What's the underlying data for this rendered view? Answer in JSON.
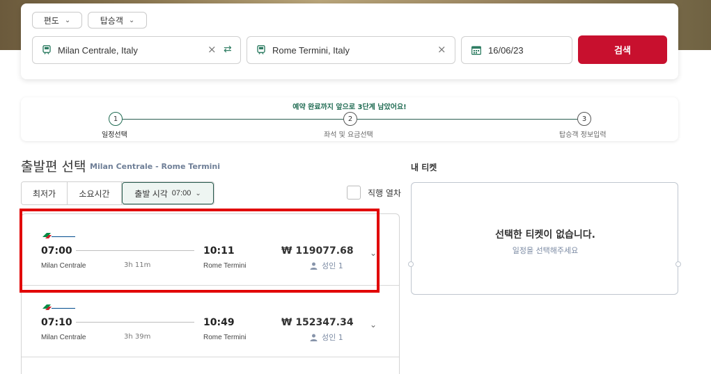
{
  "search": {
    "trip_type_label": "편도",
    "passengers_label": "탑승객",
    "origin": "Milan Centrale, Italy",
    "destination": "Rome Termini, Italy",
    "date": "16/06/23",
    "search_button": "검색"
  },
  "progress": {
    "message": "예약 완료까지 앞으로 3단계 남았어요!",
    "steps": [
      {
        "number": "1",
        "label": "일정선택",
        "active": true
      },
      {
        "number": "2",
        "label": "좌석 및 요금선택",
        "active": false
      },
      {
        "number": "3",
        "label": "탑승객 정보입력",
        "active": false
      }
    ]
  },
  "departure": {
    "title": "출발편 선택",
    "route": "Milan Centrale - Rome Termini"
  },
  "sort": {
    "cheapest": "최저가",
    "duration": "소요시간",
    "departure_time_label": "출발 시각",
    "departure_time_value": "07:00",
    "direct_only": "직행 열차"
  },
  "results": [
    {
      "operator_logo": "TRENITALIA",
      "depart_time": "07:00",
      "depart_station": "Milan Centrale",
      "duration": "3h 11m",
      "arrive_time": "10:11",
      "arrive_station": "Rome Termini",
      "price": "₩ 119077.68",
      "passengers": "성인 1"
    },
    {
      "operator_logo": "TRENITALIA",
      "depart_time": "07:10",
      "depart_station": "Milan Centrale",
      "duration": "3h 39m",
      "arrive_time": "10:49",
      "arrive_station": "Rome Termini",
      "price": "₩ 152347.34",
      "passengers": "성인 1"
    }
  ],
  "my_ticket": {
    "title": "내 티켓",
    "empty_message": "선택한 티켓이 없습니다.",
    "hint": "일정을 선택해주세요"
  },
  "colors": {
    "brand_red": "#c8102e",
    "accent_green": "#1f6b52",
    "highlight_red": "#e10000"
  }
}
